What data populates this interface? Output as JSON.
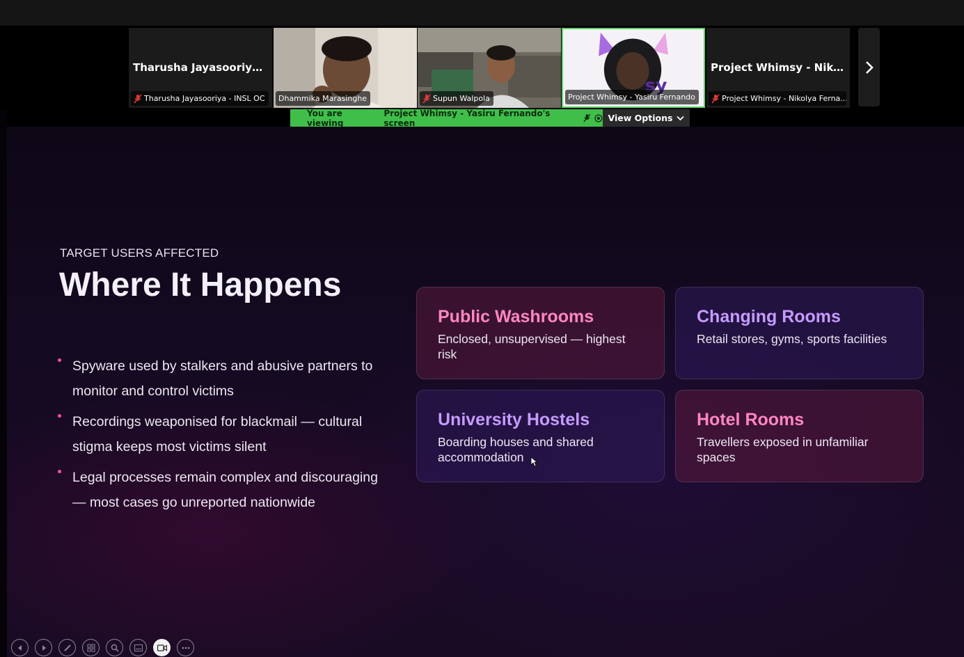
{
  "participants": [
    {
      "name": "Tharusha Jayasooriya - I...",
      "label": "Tharusha Jayasooriya - INSL OC",
      "muted": true,
      "video": false
    },
    {
      "name": "",
      "label": "Dhammika Marasinghe",
      "muted": false,
      "video": true
    },
    {
      "name": "",
      "label": "Supun Walpola",
      "muted": true,
      "video": true
    },
    {
      "name": "",
      "label": "Project Whimsy - Yasiru Fernando",
      "muted": false,
      "video": true,
      "active": true
    },
    {
      "name": "Project Whimsy - Nikoly...",
      "label": "Project Whimsy - Nikolya Ferna...",
      "muted": true,
      "video": false
    }
  ],
  "share_banner": {
    "prefix": "You are viewing",
    "presenter": "Project Whimsy - Yasiru Fernando's screen",
    "view_options": "View Options"
  },
  "slide": {
    "kicker": "TARGET USERS AFFECTED",
    "title": "Where It Happens",
    "bullets": [
      "Spyware used by stalkers and abusive partners to monitor and control victims",
      "Recordings weaponised for blackmail — cultural stigma keeps most victims silent",
      "Legal processes remain complex and discouraging — most cases go unreported nationwide"
    ],
    "cards": [
      {
        "title": "Public Washrooms",
        "desc": "Enclosed, unsupervised — highest risk",
        "color": "pink"
      },
      {
        "title": "Changing Rooms",
        "desc": "Retail stores, gyms, sports facilities",
        "color": "purple"
      },
      {
        "title": "University Hostels",
        "desc": "Boarding houses and shared accommodation",
        "color": "purple"
      },
      {
        "title": "Hotel Rooms",
        "desc": "Travellers exposed in unfamiliar spaces",
        "color": "pink"
      }
    ]
  },
  "colors": {
    "accent_green": "#3fbf4a",
    "pink_title": "#ff86c2",
    "purple_title": "#c59bff",
    "bullet": "#ff4f9a"
  },
  "slide_controls": [
    "previous-icon",
    "next-icon",
    "pen-icon",
    "slides-grid-icon",
    "zoom-icon",
    "subtitles-icon",
    "camera-icon",
    "more-icon"
  ]
}
